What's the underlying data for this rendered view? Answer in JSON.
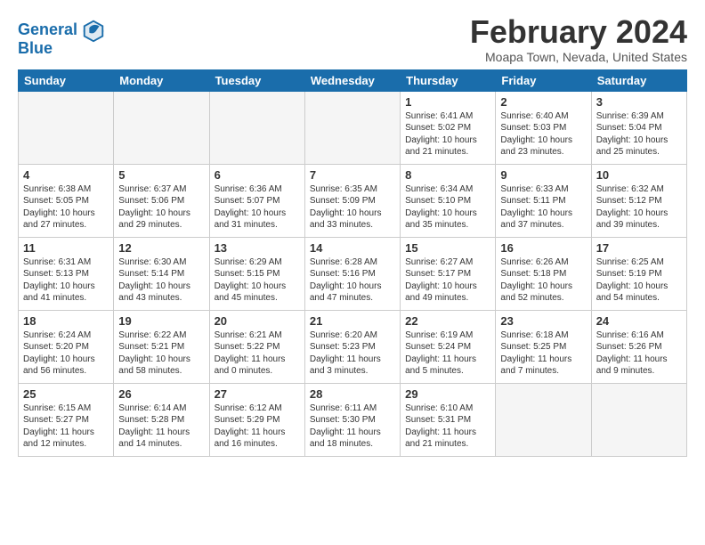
{
  "header": {
    "logo_line1": "General",
    "logo_line2": "Blue",
    "month": "February 2024",
    "location": "Moapa Town, Nevada, United States"
  },
  "weekdays": [
    "Sunday",
    "Monday",
    "Tuesday",
    "Wednesday",
    "Thursday",
    "Friday",
    "Saturday"
  ],
  "weeks": [
    [
      {
        "day": "",
        "info": ""
      },
      {
        "day": "",
        "info": ""
      },
      {
        "day": "",
        "info": ""
      },
      {
        "day": "",
        "info": ""
      },
      {
        "day": "1",
        "info": "Sunrise: 6:41 AM\nSunset: 5:02 PM\nDaylight: 10 hours\nand 21 minutes."
      },
      {
        "day": "2",
        "info": "Sunrise: 6:40 AM\nSunset: 5:03 PM\nDaylight: 10 hours\nand 23 minutes."
      },
      {
        "day": "3",
        "info": "Sunrise: 6:39 AM\nSunset: 5:04 PM\nDaylight: 10 hours\nand 25 minutes."
      }
    ],
    [
      {
        "day": "4",
        "info": "Sunrise: 6:38 AM\nSunset: 5:05 PM\nDaylight: 10 hours\nand 27 minutes."
      },
      {
        "day": "5",
        "info": "Sunrise: 6:37 AM\nSunset: 5:06 PM\nDaylight: 10 hours\nand 29 minutes."
      },
      {
        "day": "6",
        "info": "Sunrise: 6:36 AM\nSunset: 5:07 PM\nDaylight: 10 hours\nand 31 minutes."
      },
      {
        "day": "7",
        "info": "Sunrise: 6:35 AM\nSunset: 5:09 PM\nDaylight: 10 hours\nand 33 minutes."
      },
      {
        "day": "8",
        "info": "Sunrise: 6:34 AM\nSunset: 5:10 PM\nDaylight: 10 hours\nand 35 minutes."
      },
      {
        "day": "9",
        "info": "Sunrise: 6:33 AM\nSunset: 5:11 PM\nDaylight: 10 hours\nand 37 minutes."
      },
      {
        "day": "10",
        "info": "Sunrise: 6:32 AM\nSunset: 5:12 PM\nDaylight: 10 hours\nand 39 minutes."
      }
    ],
    [
      {
        "day": "11",
        "info": "Sunrise: 6:31 AM\nSunset: 5:13 PM\nDaylight: 10 hours\nand 41 minutes."
      },
      {
        "day": "12",
        "info": "Sunrise: 6:30 AM\nSunset: 5:14 PM\nDaylight: 10 hours\nand 43 minutes."
      },
      {
        "day": "13",
        "info": "Sunrise: 6:29 AM\nSunset: 5:15 PM\nDaylight: 10 hours\nand 45 minutes."
      },
      {
        "day": "14",
        "info": "Sunrise: 6:28 AM\nSunset: 5:16 PM\nDaylight: 10 hours\nand 47 minutes."
      },
      {
        "day": "15",
        "info": "Sunrise: 6:27 AM\nSunset: 5:17 PM\nDaylight: 10 hours\nand 49 minutes."
      },
      {
        "day": "16",
        "info": "Sunrise: 6:26 AM\nSunset: 5:18 PM\nDaylight: 10 hours\nand 52 minutes."
      },
      {
        "day": "17",
        "info": "Sunrise: 6:25 AM\nSunset: 5:19 PM\nDaylight: 10 hours\nand 54 minutes."
      }
    ],
    [
      {
        "day": "18",
        "info": "Sunrise: 6:24 AM\nSunset: 5:20 PM\nDaylight: 10 hours\nand 56 minutes."
      },
      {
        "day": "19",
        "info": "Sunrise: 6:22 AM\nSunset: 5:21 PM\nDaylight: 10 hours\nand 58 minutes."
      },
      {
        "day": "20",
        "info": "Sunrise: 6:21 AM\nSunset: 5:22 PM\nDaylight: 11 hours\nand 0 minutes."
      },
      {
        "day": "21",
        "info": "Sunrise: 6:20 AM\nSunset: 5:23 PM\nDaylight: 11 hours\nand 3 minutes."
      },
      {
        "day": "22",
        "info": "Sunrise: 6:19 AM\nSunset: 5:24 PM\nDaylight: 11 hours\nand 5 minutes."
      },
      {
        "day": "23",
        "info": "Sunrise: 6:18 AM\nSunset: 5:25 PM\nDaylight: 11 hours\nand 7 minutes."
      },
      {
        "day": "24",
        "info": "Sunrise: 6:16 AM\nSunset: 5:26 PM\nDaylight: 11 hours\nand 9 minutes."
      }
    ],
    [
      {
        "day": "25",
        "info": "Sunrise: 6:15 AM\nSunset: 5:27 PM\nDaylight: 11 hours\nand 12 minutes."
      },
      {
        "day": "26",
        "info": "Sunrise: 6:14 AM\nSunset: 5:28 PM\nDaylight: 11 hours\nand 14 minutes."
      },
      {
        "day": "27",
        "info": "Sunrise: 6:12 AM\nSunset: 5:29 PM\nDaylight: 11 hours\nand 16 minutes."
      },
      {
        "day": "28",
        "info": "Sunrise: 6:11 AM\nSunset: 5:30 PM\nDaylight: 11 hours\nand 18 minutes."
      },
      {
        "day": "29",
        "info": "Sunrise: 6:10 AM\nSunset: 5:31 PM\nDaylight: 11 hours\nand 21 minutes."
      },
      {
        "day": "",
        "info": ""
      },
      {
        "day": "",
        "info": ""
      }
    ]
  ]
}
